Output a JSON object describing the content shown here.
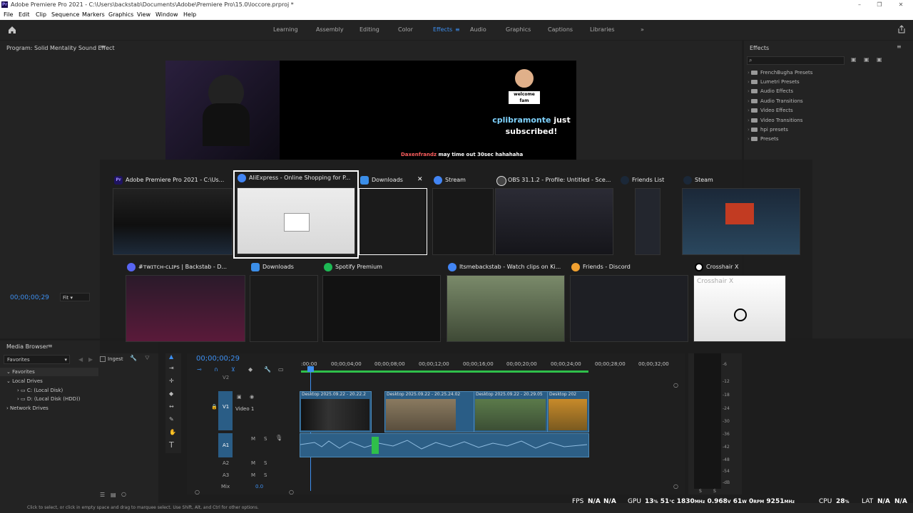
{
  "window": {
    "title": "Adobe Premiere Pro 2021 - C:\\Users\\backstab\\Documents\\Adobe\\Premiere Pro\\15.0\\loccore.prproj *",
    "app_icon": "Pr"
  },
  "menu": [
    "File",
    "Edit",
    "Clip",
    "Sequence",
    "Markers",
    "Graphics",
    "View",
    "Window",
    "Help"
  ],
  "workspaces": [
    {
      "label": "Learning"
    },
    {
      "label": "Assembly"
    },
    {
      "label": "Editing"
    },
    {
      "label": "Color"
    },
    {
      "label": "Effects",
      "active": true
    },
    {
      "label": "Audio"
    },
    {
      "label": "Graphics"
    },
    {
      "label": "Captions"
    },
    {
      "label": "Libraries"
    }
  ],
  "program_monitor": {
    "title": "Program: Solid Mentality Sound Effect",
    "timecode": "00;00;00;29",
    "fit": "Fit",
    "stream": {
      "sub_user": "cplibramonte",
      "sub_text": "just",
      "sub_text2": "subscribed!",
      "welcome": "welcome fam",
      "chat_line1_user": "Daxenfrandz",
      "chat_line1_text": "may time out 30sec hahahaha"
    }
  },
  "effects_panel": {
    "title": "Effects",
    "items": [
      "FrenchBugha Presets",
      "Lumetri Presets",
      "Audio Effects",
      "Audio Transitions",
      "Video Effects",
      "Video Transitions",
      "hpi presets",
      "Presets"
    ]
  },
  "task_switcher": {
    "row1": [
      {
        "title": "Adobe Premiere Pro 2021 - C:\\Us...",
        "icon_color": "#1f1460",
        "icon": "Pr"
      },
      {
        "title": "AliExpress - Online Shopping for P...",
        "icon_color": "#4285f4",
        "icon": "chrome",
        "selected": true
      },
      {
        "title": "Downloads",
        "icon_color": "#3b8ee8",
        "icon": "download",
        "close": "✕"
      },
      {
        "title": "Stream",
        "icon_color": "#4285f4",
        "icon": "chrome"
      },
      {
        "title": "OBS 31.1.2 - Profile: Untitled - Sce...",
        "icon_color": "#444",
        "icon": "obs"
      },
      {
        "title": "Friends List",
        "icon_color": "#1b2838",
        "icon": "steam"
      },
      {
        "title": "Steam",
        "icon_color": "#1b2838",
        "icon": "steam"
      }
    ],
    "row2": [
      {
        "title": "#ᴛᴡɪᴛᴄʜ-ᴄʟɪᴘs | Backstab - D...",
        "icon_color": "#5865f2",
        "icon": "discord"
      },
      {
        "title": "Downloads",
        "icon_color": "#3b8ee8",
        "icon": "download"
      },
      {
        "title": "Spotify Premium",
        "icon_color": "#1db954",
        "icon": "spotify"
      },
      {
        "title": "Itsmebackstab - Watch clips on Ki...",
        "icon_color": "#4285f4",
        "icon": "chrome"
      },
      {
        "title": "Friends - Discord",
        "icon_color": "#f0a030",
        "icon": "discord"
      },
      {
        "title": "Crosshair X",
        "icon_color": "#ffffff",
        "icon": "crosshair",
        "thumb_text": "Crosshair X"
      }
    ]
  },
  "media_browser": {
    "title": "Media Browser",
    "dropdown": "Favorites",
    "ingest": "Ingest",
    "tree": [
      "Favorites",
      "Local Drives",
      "C: (Local Disk)",
      "D: (Local Disk (HDD))",
      "Network Drives"
    ]
  },
  "timeline": {
    "timecode": "00;00;00;29",
    "ruler": [
      ":00;00",
      "00;00;04;00",
      "00;00;08;00",
      "00;00;12;00",
      "00;00;16;00",
      "00;00;20;00",
      "00;00;24;00",
      "00;00;28;00",
      "00;00;32;00"
    ],
    "tracks": {
      "v2": "V2",
      "v1": "V1",
      "v1_name": "Video 1",
      "a1": "A1",
      "a2": "A2",
      "a3": "A3",
      "mix": "Mix",
      "mix_val": "0.0"
    },
    "clips": [
      {
        "label": "Desktop 2025.09.22 - 20.22.2"
      },
      {
        "label": "Desktop 2025.09.22 - 20.25.24.02"
      },
      {
        "label": "Desktop 2025.09.22 - 20.29.05"
      },
      {
        "label": "Desktop 202"
      }
    ]
  },
  "meter": {
    "scale": [
      "-6",
      "-12",
      "-18",
      "-24",
      "-30",
      "-36",
      "-42",
      "-48",
      "-54",
      "-dB"
    ],
    "solo": "S"
  },
  "status": {
    "hint": "Click to select, or click in empty space and drag to marquee select. Use Shift, Alt, and Ctrl for other options.",
    "fps_label": "FPS",
    "fps_val": "N/A",
    "fps_val2": "N/A",
    "gpu_label": "GPU",
    "gpu_pct": "13",
    "gpu_temp": "51",
    "gpu_clock": "1830",
    "gpu_volt": "0.968",
    "gpu_watt": "61",
    "gpu_rpm": "0",
    "gpu_mem": "9251",
    "cpu_label": "CPU",
    "cpu_pct": "28",
    "lat_label": "LAT",
    "lat_val": "N/A",
    "lat_val2": "N/A"
  },
  "colors": {
    "accent": "#3d8ff0",
    "bg": "#1d1d1d",
    "panel": "#232323",
    "clip": "#2a5d86"
  }
}
